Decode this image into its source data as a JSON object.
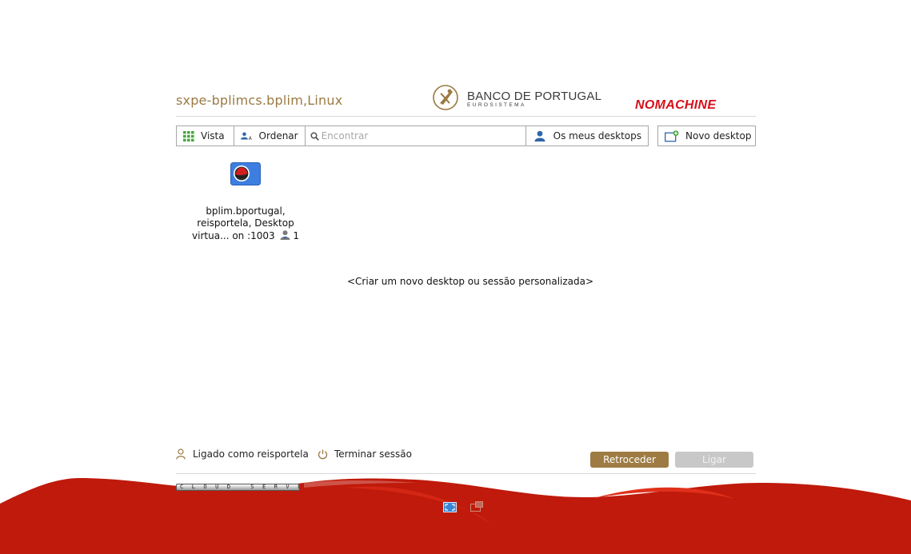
{
  "header": {
    "host_title": "sxpe-bplimcs.bplim,Linux",
    "brand_name": "BANCO DE PORTUGAL",
    "brand_sub": "EUROSISTEMA",
    "product": "NOMACHINE"
  },
  "toolbar": {
    "view_label": "Vista",
    "sort_label": "Ordenar",
    "search_placeholder": "Encontrar",
    "my_desktops_label": "Os meus desktops",
    "new_desktop_label": "Novo desktop"
  },
  "sessions": [
    {
      "line1": "bplim.bportugal,",
      "line2": "reisportela, Desktop",
      "line3": "virtua... on :1003",
      "user_count": "1",
      "icon": "redhat-icon"
    }
  ],
  "main": {
    "create_link": "<Criar um novo desktop ou sessão personalizada>"
  },
  "footer": {
    "logged_as": "Ligado como reisportela",
    "logout": "Terminar sessão",
    "back_button": "Retroceder",
    "connect_button": "Ligar",
    "edition": "CLOUD SERVER"
  },
  "colors": {
    "accent_gold": "#9d7b42",
    "brand_red": "#c01a0c",
    "nomachine_red": "#d5111b"
  }
}
